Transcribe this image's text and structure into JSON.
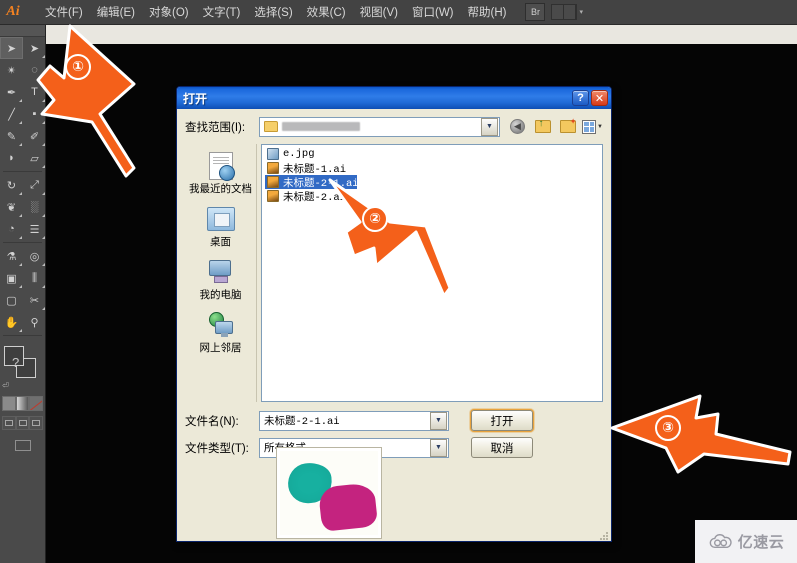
{
  "app": {
    "name": "Adobe Illustrator",
    "logo_text": "Ai",
    "menu_items": [
      {
        "label": "文件(F)",
        "name": "menu-file"
      },
      {
        "label": "编辑(E)",
        "name": "menu-edit"
      },
      {
        "label": "对象(O)",
        "name": "menu-object"
      },
      {
        "label": "文字(T)",
        "name": "menu-type"
      },
      {
        "label": "选择(S)",
        "name": "menu-select"
      },
      {
        "label": "效果(C)",
        "name": "menu-effect"
      },
      {
        "label": "视图(V)",
        "name": "menu-view"
      },
      {
        "label": "窗口(W)",
        "name": "menu-window"
      },
      {
        "label": "帮助(H)",
        "name": "menu-help"
      }
    ],
    "bridge_button": "Br",
    "arrange_caret": "▾"
  },
  "toolbar": {
    "tools": [
      {
        "glyph": "➤",
        "name": "selection-tool",
        "selected": true
      },
      {
        "glyph": "➤",
        "name": "direct-selection-tool",
        "selected": false
      },
      {
        "glyph": "✴",
        "name": "magic-wand-tool",
        "selected": false
      },
      {
        "glyph": "◌",
        "name": "lasso-tool",
        "selected": false
      },
      {
        "glyph": "✒",
        "name": "pen-tool",
        "selected": false
      },
      {
        "glyph": "T",
        "name": "type-tool",
        "selected": false
      },
      {
        "glyph": "╱",
        "name": "line-segment-tool",
        "selected": false
      },
      {
        "glyph": "■",
        "name": "rectangle-tool",
        "selected": false
      },
      {
        "glyph": "✎",
        "name": "paintbrush-tool",
        "selected": false
      },
      {
        "glyph": "✐",
        "name": "pencil-tool",
        "selected": false
      },
      {
        "glyph": "◗",
        "name": "blob-brush-tool",
        "selected": false
      },
      {
        "glyph": "▱",
        "name": "eraser-tool",
        "selected": false
      },
      {
        "glyph": "↻",
        "name": "rotate-tool",
        "selected": false
      },
      {
        "glyph": "⤢",
        "name": "scale-tool",
        "selected": false
      },
      {
        "glyph": "❦",
        "name": "warp-tool",
        "selected": false
      },
      {
        "glyph": "░",
        "name": "free-transform-tool",
        "selected": false
      },
      {
        "glyph": "◔",
        "name": "shape-builder-tool",
        "selected": false
      },
      {
        "glyph": "☰",
        "name": "graph-tool",
        "selected": false
      },
      {
        "glyph": "▨",
        "name": "mesh-tool",
        "selected": false
      },
      {
        "glyph": "▤",
        "name": "gradient-tool",
        "selected": false
      },
      {
        "glyph": "⚗",
        "name": "eyedropper-tool",
        "selected": false
      },
      {
        "glyph": "◎",
        "name": "blend-tool",
        "selected": false
      },
      {
        "glyph": "▣",
        "name": "symbol-sprayer-tool",
        "selected": false
      },
      {
        "glyph": "⫼",
        "name": "column-graph-tool",
        "selected": false
      },
      {
        "glyph": "▢",
        "name": "artboard-tool",
        "selected": false
      },
      {
        "glyph": "✂",
        "name": "slice-tool",
        "selected": false
      },
      {
        "glyph": "✋",
        "name": "hand-tool",
        "selected": false
      },
      {
        "glyph": "⚲",
        "name": "zoom-tool",
        "selected": false
      }
    ],
    "fill_stroke_label": "?",
    "swatches": [
      {
        "name": "color-swatch",
        "kind": "solid"
      },
      {
        "name": "gradient-swatch",
        "kind": "grad"
      },
      {
        "name": "none-swatch",
        "kind": "none"
      }
    ],
    "screen_modes": [
      "normal-screen-mode",
      "full-screen-menubar-mode",
      "full-screen-mode"
    ]
  },
  "dialog": {
    "title": "打开",
    "help_button": "?",
    "close_button": "✕",
    "look_in": {
      "label": "查找范围(I):",
      "value": "",
      "dropdown_caret": "▼"
    },
    "nav_tools": [
      {
        "name": "back-button",
        "glyph": "◀"
      },
      {
        "name": "up-one-level-button",
        "glyph": "↑"
      },
      {
        "name": "create-new-folder-button",
        "glyph": "✦"
      },
      {
        "name": "views-button",
        "glyph": "▦"
      }
    ],
    "places": [
      {
        "label": "我最近的文档",
        "icon": "recent-documents-icon",
        "name": "place-recent-documents"
      },
      {
        "label": "桌面",
        "icon": "desktop-icon",
        "name": "place-desktop"
      },
      {
        "label": "我的电脑",
        "icon": "my-computer-icon",
        "name": "place-my-computer"
      },
      {
        "label": "网上邻居",
        "icon": "network-places-icon",
        "name": "place-network"
      }
    ],
    "files": [
      {
        "name": "e.jpg",
        "type": "jpg",
        "selected": false
      },
      {
        "name": "未标题-1.ai",
        "type": "ai",
        "selected": false
      },
      {
        "name": "未标题-2-1.ai",
        "type": "ai",
        "selected": true
      },
      {
        "name": "未标题-2.ai",
        "type": "ai",
        "selected": false
      }
    ],
    "filename": {
      "label": "文件名(N):",
      "value": "未标题-2-1.ai",
      "dropdown_caret": "▼"
    },
    "filetype": {
      "label": "文件类型(T):",
      "value": "所有格式",
      "dropdown_caret": "▼"
    },
    "open_button": "打开",
    "cancel_button": "取消",
    "preview": {
      "teal_color": "#17b0a0",
      "magenta_color": "#c4237f"
    }
  },
  "annotations": [
    {
      "number": "①",
      "name": "annotation-arrow-1",
      "target": "file-menu"
    },
    {
      "number": "②",
      "name": "annotation-arrow-2",
      "target": "selected-file"
    },
    {
      "number": "③",
      "name": "annotation-arrow-3",
      "target": "open-button"
    }
  ],
  "annotation_color": "#f4601a",
  "watermark": {
    "text": "亿速云",
    "icon": "cloud-icon"
  }
}
